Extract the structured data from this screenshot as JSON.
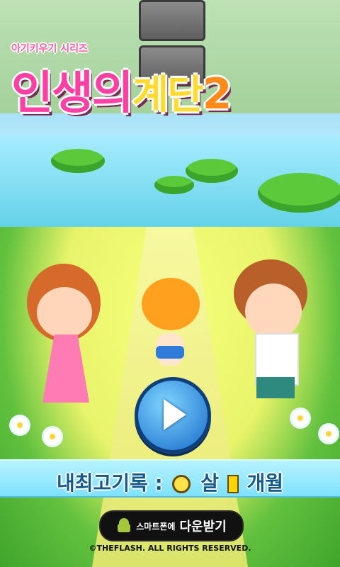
{
  "title": {
    "series": "아기키우기 시리즈",
    "game_title_a": "인생의",
    "game_title_b": "계단",
    "game_number": "2"
  },
  "record": {
    "label": "내최고기록 :",
    "age_value": "",
    "age_unit": "살",
    "month_value": "",
    "month_unit": "개월"
  },
  "download": {
    "prefix": "스마트폰에",
    "label": "다운받기"
  },
  "footer": {
    "copyright": "©THEFLASH. ALL RIGHTS RESERVED."
  }
}
